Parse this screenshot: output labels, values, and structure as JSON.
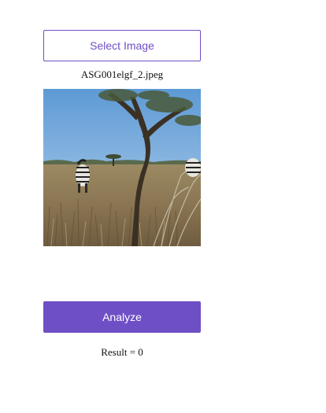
{
  "upload": {
    "select_label": "Select Image",
    "filename": "ASG001elgf_2.jpeg"
  },
  "preview": {
    "icon": "savanna-photo-with-zebra"
  },
  "actions": {
    "analyze_label": "Analyze"
  },
  "result": {
    "text": "Result = 0"
  },
  "colors": {
    "accent": "#6f4fc6",
    "background": "#ffffff"
  }
}
